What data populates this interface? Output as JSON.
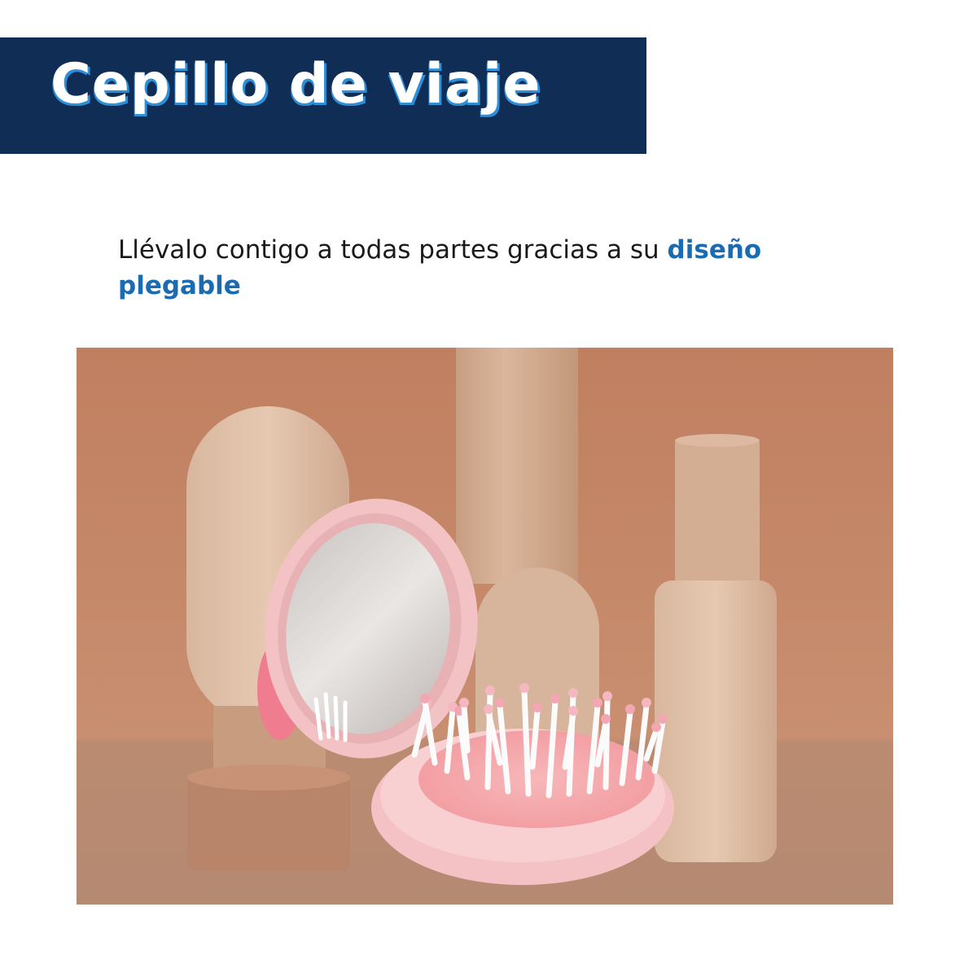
{
  "title": "Cepillo de viaje",
  "subtitle": {
    "text": "Llévalo contigo a todas partes gracias a su ",
    "highlight": "diseño plegable"
  },
  "colors": {
    "title_bar": "#0f2d55",
    "title_shadow": "#2d8fd8",
    "highlight": "#1b6bb3",
    "photo_background": "#c48a6c",
    "brush_pink": "#f6c9cb"
  }
}
